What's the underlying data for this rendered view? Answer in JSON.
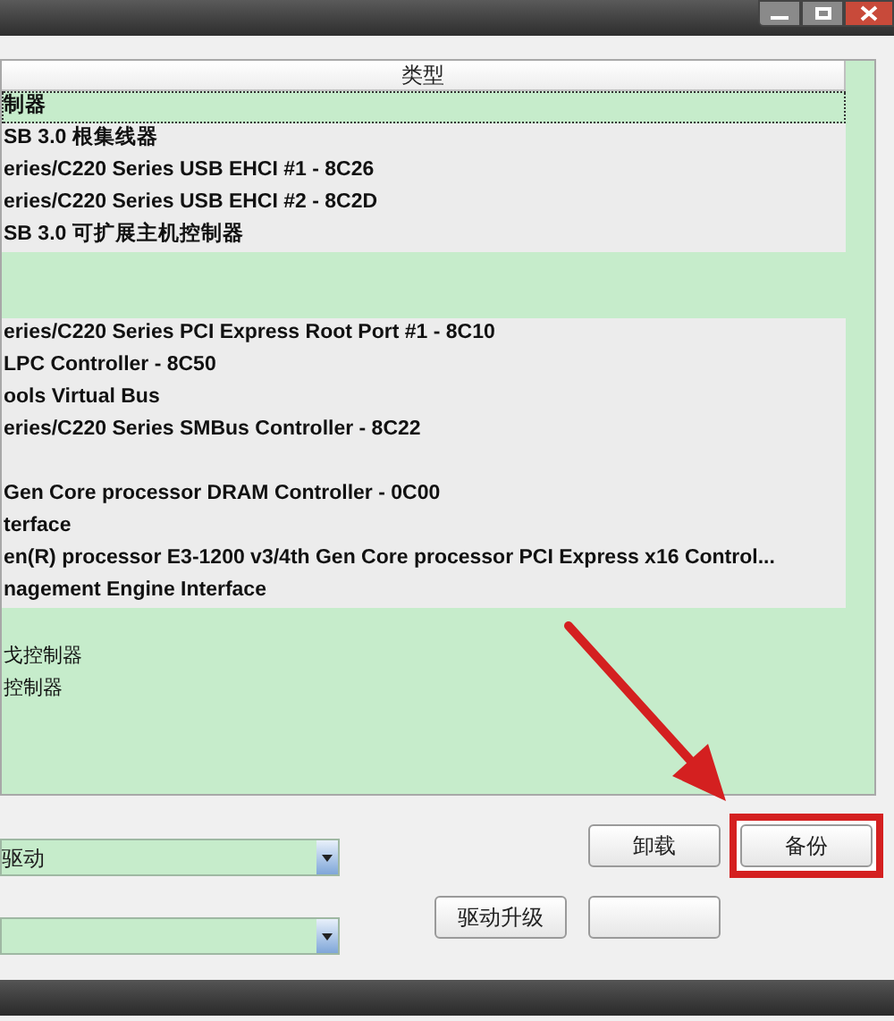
{
  "list": {
    "column_header": "类型",
    "groups": [
      {
        "kind": "block",
        "rows": [
          {
            "kind": "device",
            "text": "制器",
            "selected": true
          },
          {
            "kind": "device",
            "text": "SB 3.0 根集线器",
            "selected": false
          },
          {
            "kind": "device",
            "text": "eries/C220 Series USB EHCI #1 - 8C26",
            "selected": false
          },
          {
            "kind": "device",
            "text": "eries/C220 Series USB EHCI #2 - 8C2D",
            "selected": false
          },
          {
            "kind": "device",
            "text": "SB 3.0 可扩展主机控制器",
            "selected": false
          }
        ]
      },
      {
        "kind": "block",
        "rows": [
          {
            "kind": "device",
            "text": "eries/C220 Series PCI Express Root Port #1 - 8C10",
            "selected": false
          },
          {
            "kind": "device",
            "text": "LPC Controller - 8C50",
            "selected": false
          },
          {
            "kind": "device",
            "text": "ools Virtual Bus",
            "selected": false
          },
          {
            "kind": "device",
            "text": "eries/C220 Series SMBus Controller - 8C22",
            "selected": false
          },
          {
            "kind": "spacer"
          },
          {
            "kind": "device",
            "text": "Gen Core processor DRAM Controller - 0C00",
            "selected": false
          },
          {
            "kind": "device",
            "text": "terface",
            "selected": false
          },
          {
            "kind": "device",
            "text": "en(R) processor E3-1200 v3/4th Gen Core processor PCI Express x16 Control...",
            "selected": false
          },
          {
            "kind": "device",
            "text": "nagement Engine Interface",
            "selected": false
          }
        ]
      },
      {
        "kind": "plain",
        "rows": [
          {
            "kind": "category",
            "text": "戈控制器",
            "selected": false
          },
          {
            "kind": "category",
            "text": "控制器",
            "selected": false
          }
        ]
      }
    ]
  },
  "dropdowns": [
    {
      "kind": "filled",
      "value": "驱动"
    },
    {
      "kind": "blank"
    }
  ],
  "buttons": [
    {
      "label": "卸载",
      "highlighted": false
    },
    {
      "label": "备份",
      "highlighted": true
    },
    {
      "label": "驱动升级",
      "highlighted": false
    }
  ]
}
